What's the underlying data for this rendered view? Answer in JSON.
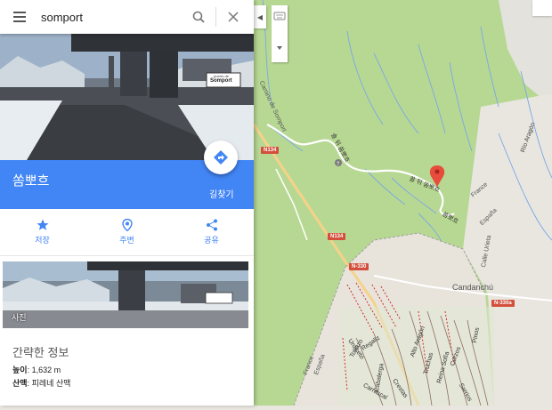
{
  "search": {
    "value": "somport"
  },
  "place": {
    "name": "쏨뽀흐",
    "directions_label": "길찾기"
  },
  "actions": [
    {
      "label": "저장",
      "icon": "star-icon"
    },
    {
      "label": "주변",
      "icon": "nearby-icon"
    },
    {
      "label": "공유",
      "icon": "share-icon"
    }
  ],
  "photos": {
    "label": "사진"
  },
  "info": {
    "title": "간략한 정보",
    "elevation_label": "높이",
    "elevation_value": ": 1,632 m",
    "range_label": "산맥",
    "range_value": ": 피레네 산맥"
  },
  "hero": {
    "sign_top": "puerto de",
    "sign_main": "Somport"
  },
  "map": {
    "town": "Candanchú",
    "roads": [
      "N134",
      "N134",
      "N-330",
      "N-330a"
    ],
    "labels": {
      "camino": "Camino de Somport",
      "river": "Río Aragón",
      "road_korean_1": "솔 뒤 쏨뽀흐",
      "road_korean_2": "쏠 뒤 쏨뽀흐",
      "road_korean_3": "쏨뽀흐",
      "france_1": "France",
      "espana_1": "España",
      "france_2": "France",
      "espana_2": "España",
      "calle": "Calle Urieta",
      "pista_1": "Tobazo",
      "pista_2": "Alto Aragón",
      "pista_3": "Regaliz",
      "pista_4": "Pinos",
      "pista_5": "Truchas",
      "pista_6": "Reina Sofía",
      "pista_7": "Corzos",
      "pista_8": "Cabalerga",
      "pista_9": "Carrascal",
      "pista_10": "Sarrios",
      "pista_11": "Crestas",
      "pista_12": "Urdiceto"
    }
  },
  "colors": {
    "accent": "#4285f4",
    "pin": "#e74c3c",
    "forest": "#b3d58f"
  }
}
